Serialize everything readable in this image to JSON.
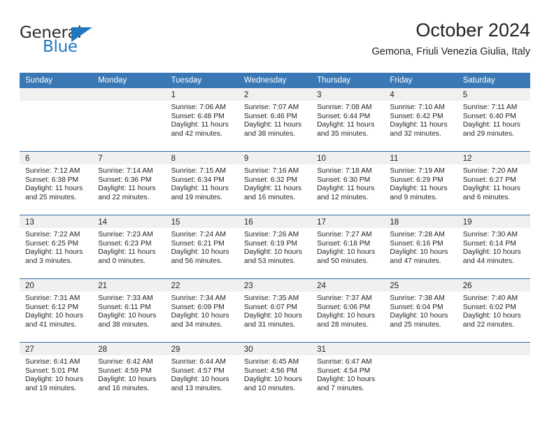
{
  "brand": {
    "name_top": "General",
    "name_bottom": "Blue",
    "accent_color": "#2077c0"
  },
  "header": {
    "title": "October 2024",
    "subtitle": "Gemona, Friuli Venezia Giulia, Italy"
  },
  "theme": {
    "header_row_bg": "#3a78b5",
    "header_row_text": "#ffffff",
    "date_band_bg": "#f0f0f0",
    "week_separator": "#2d6ca8",
    "body_text": "#231f20"
  },
  "calendar": {
    "weekday_headers": [
      "Sunday",
      "Monday",
      "Tuesday",
      "Wednesday",
      "Thursday",
      "Friday",
      "Saturday"
    ],
    "weeks": [
      [
        {
          "date": "",
          "empty": true
        },
        {
          "date": "",
          "empty": true
        },
        {
          "date": "1",
          "sunrise": "Sunrise: 7:06 AM",
          "sunset": "Sunset: 6:48 PM",
          "daylight": "Daylight: 11 hours and 42 minutes."
        },
        {
          "date": "2",
          "sunrise": "Sunrise: 7:07 AM",
          "sunset": "Sunset: 6:46 PM",
          "daylight": "Daylight: 11 hours and 38 minutes."
        },
        {
          "date": "3",
          "sunrise": "Sunrise: 7:08 AM",
          "sunset": "Sunset: 6:44 PM",
          "daylight": "Daylight: 11 hours and 35 minutes."
        },
        {
          "date": "4",
          "sunrise": "Sunrise: 7:10 AM",
          "sunset": "Sunset: 6:42 PM",
          "daylight": "Daylight: 11 hours and 32 minutes."
        },
        {
          "date": "5",
          "sunrise": "Sunrise: 7:11 AM",
          "sunset": "Sunset: 6:40 PM",
          "daylight": "Daylight: 11 hours and 29 minutes."
        }
      ],
      [
        {
          "date": "6",
          "sunrise": "Sunrise: 7:12 AM",
          "sunset": "Sunset: 6:38 PM",
          "daylight": "Daylight: 11 hours and 25 minutes."
        },
        {
          "date": "7",
          "sunrise": "Sunrise: 7:14 AM",
          "sunset": "Sunset: 6:36 PM",
          "daylight": "Daylight: 11 hours and 22 minutes."
        },
        {
          "date": "8",
          "sunrise": "Sunrise: 7:15 AM",
          "sunset": "Sunset: 6:34 PM",
          "daylight": "Daylight: 11 hours and 19 minutes."
        },
        {
          "date": "9",
          "sunrise": "Sunrise: 7:16 AM",
          "sunset": "Sunset: 6:32 PM",
          "daylight": "Daylight: 11 hours and 16 minutes."
        },
        {
          "date": "10",
          "sunrise": "Sunrise: 7:18 AM",
          "sunset": "Sunset: 6:30 PM",
          "daylight": "Daylight: 11 hours and 12 minutes."
        },
        {
          "date": "11",
          "sunrise": "Sunrise: 7:19 AM",
          "sunset": "Sunset: 6:29 PM",
          "daylight": "Daylight: 11 hours and 9 minutes."
        },
        {
          "date": "12",
          "sunrise": "Sunrise: 7:20 AM",
          "sunset": "Sunset: 6:27 PM",
          "daylight": "Daylight: 11 hours and 6 minutes."
        }
      ],
      [
        {
          "date": "13",
          "sunrise": "Sunrise: 7:22 AM",
          "sunset": "Sunset: 6:25 PM",
          "daylight": "Daylight: 11 hours and 3 minutes."
        },
        {
          "date": "14",
          "sunrise": "Sunrise: 7:23 AM",
          "sunset": "Sunset: 6:23 PM",
          "daylight": "Daylight: 11 hours and 0 minutes."
        },
        {
          "date": "15",
          "sunrise": "Sunrise: 7:24 AM",
          "sunset": "Sunset: 6:21 PM",
          "daylight": "Daylight: 10 hours and 56 minutes."
        },
        {
          "date": "16",
          "sunrise": "Sunrise: 7:26 AM",
          "sunset": "Sunset: 6:19 PM",
          "daylight": "Daylight: 10 hours and 53 minutes."
        },
        {
          "date": "17",
          "sunrise": "Sunrise: 7:27 AM",
          "sunset": "Sunset: 6:18 PM",
          "daylight": "Daylight: 10 hours and 50 minutes."
        },
        {
          "date": "18",
          "sunrise": "Sunrise: 7:28 AM",
          "sunset": "Sunset: 6:16 PM",
          "daylight": "Daylight: 10 hours and 47 minutes."
        },
        {
          "date": "19",
          "sunrise": "Sunrise: 7:30 AM",
          "sunset": "Sunset: 6:14 PM",
          "daylight": "Daylight: 10 hours and 44 minutes."
        }
      ],
      [
        {
          "date": "20",
          "sunrise": "Sunrise: 7:31 AM",
          "sunset": "Sunset: 6:12 PM",
          "daylight": "Daylight: 10 hours and 41 minutes."
        },
        {
          "date": "21",
          "sunrise": "Sunrise: 7:33 AM",
          "sunset": "Sunset: 6:11 PM",
          "daylight": "Daylight: 10 hours and 38 minutes."
        },
        {
          "date": "22",
          "sunrise": "Sunrise: 7:34 AM",
          "sunset": "Sunset: 6:09 PM",
          "daylight": "Daylight: 10 hours and 34 minutes."
        },
        {
          "date": "23",
          "sunrise": "Sunrise: 7:35 AM",
          "sunset": "Sunset: 6:07 PM",
          "daylight": "Daylight: 10 hours and 31 minutes."
        },
        {
          "date": "24",
          "sunrise": "Sunrise: 7:37 AM",
          "sunset": "Sunset: 6:06 PM",
          "daylight": "Daylight: 10 hours and 28 minutes."
        },
        {
          "date": "25",
          "sunrise": "Sunrise: 7:38 AM",
          "sunset": "Sunset: 6:04 PM",
          "daylight": "Daylight: 10 hours and 25 minutes."
        },
        {
          "date": "26",
          "sunrise": "Sunrise: 7:40 AM",
          "sunset": "Sunset: 6:02 PM",
          "daylight": "Daylight: 10 hours and 22 minutes."
        }
      ],
      [
        {
          "date": "27",
          "sunrise": "Sunrise: 6:41 AM",
          "sunset": "Sunset: 5:01 PM",
          "daylight": "Daylight: 10 hours and 19 minutes."
        },
        {
          "date": "28",
          "sunrise": "Sunrise: 6:42 AM",
          "sunset": "Sunset: 4:59 PM",
          "daylight": "Daylight: 10 hours and 16 minutes."
        },
        {
          "date": "29",
          "sunrise": "Sunrise: 6:44 AM",
          "sunset": "Sunset: 4:57 PM",
          "daylight": "Daylight: 10 hours and 13 minutes."
        },
        {
          "date": "30",
          "sunrise": "Sunrise: 6:45 AM",
          "sunset": "Sunset: 4:56 PM",
          "daylight": "Daylight: 10 hours and 10 minutes."
        },
        {
          "date": "31",
          "sunrise": "Sunrise: 6:47 AM",
          "sunset": "Sunset: 4:54 PM",
          "daylight": "Daylight: 10 hours and 7 minutes."
        },
        {
          "date": "",
          "empty": true
        },
        {
          "date": "",
          "empty": true
        }
      ]
    ]
  }
}
